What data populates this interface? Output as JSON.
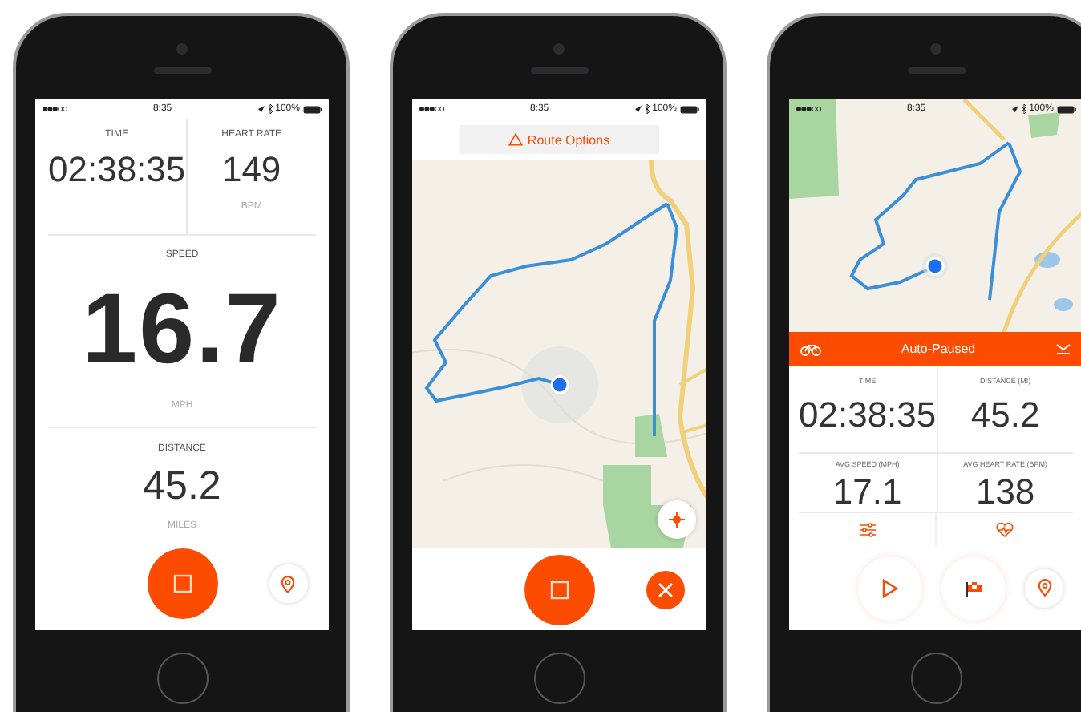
{
  "phones": [
    {
      "kind": "stats",
      "status_bar": {
        "time": "8:35",
        "battery": "100%"
      },
      "metrics": [
        {
          "kind": "half",
          "label": "TIME",
          "value": "02:38:35"
        },
        {
          "kind": "half",
          "label": "HEART RATE",
          "value": "149",
          "unit": "BPM"
        },
        {
          "kind": "hero",
          "label": "SPEED",
          "value": "16.7",
          "unit": "MPH"
        },
        {
          "kind": "full",
          "label": "DISTANCE",
          "value": "45.2",
          "unit": "MILES"
        }
      ],
      "actions": [
        {
          "kind": "stop"
        },
        {
          "kind": "location"
        }
      ]
    },
    {
      "kind": "route_map",
      "status_bar": {
        "time": "8:35",
        "battery": "100%"
      },
      "header": {
        "button": "Route Options"
      },
      "map": {
        "kind": "picture"
      },
      "map_button": {
        "kind": "recenter"
      },
      "actions": [
        {
          "kind": "stop"
        },
        {
          "kind": "close"
        }
      ]
    },
    {
      "kind": "paused",
      "status_bar": {
        "time": "8:35",
        "battery": "100%"
      },
      "map": {
        "kind": "picture"
      },
      "banner": {
        "text": "Auto-Paused"
      },
      "metrics": [
        {
          "kind": "tile",
          "label": "TIME",
          "value": "02:38:35"
        },
        {
          "kind": "tile",
          "label": "DISTANCE (MI)",
          "value": "45.2"
        },
        {
          "kind": "tile",
          "label": "AVG SPEED (MPH)",
          "value": "17.1"
        },
        {
          "kind": "tile",
          "label": "AVG HEART RATE (BPM)",
          "value": "138"
        }
      ],
      "tools": [
        {
          "kind": "settings"
        },
        {
          "kind": "heart"
        }
      ],
      "actions": [
        {
          "kind": "play"
        },
        {
          "kind": "finish"
        },
        {
          "kind": "location"
        }
      ]
    }
  ]
}
